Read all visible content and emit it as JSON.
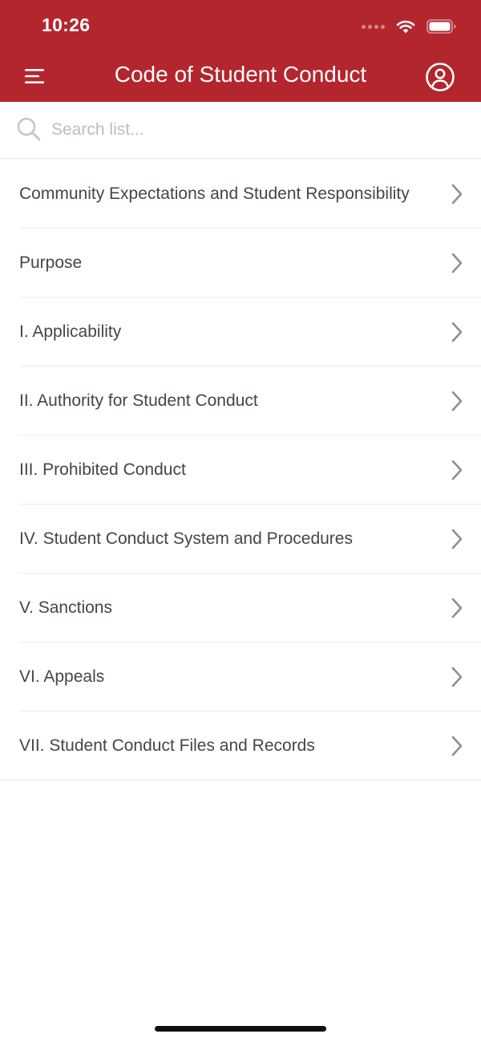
{
  "status_bar": {
    "time": "10:26"
  },
  "nav": {
    "title": "Code of Student Conduct",
    "menu_icon": "hamburger-menu-icon",
    "account_icon": "user-circle-icon"
  },
  "search": {
    "placeholder": "Search list...",
    "value": ""
  },
  "list": {
    "items": [
      {
        "label": "Community Expectations and Student Responsibility"
      },
      {
        "label": "Purpose"
      },
      {
        "label": "I. Applicability"
      },
      {
        "label": "II. Authority for Student Conduct"
      },
      {
        "label": "III. Prohibited Conduct"
      },
      {
        "label": "IV. Student Conduct System and Procedures"
      },
      {
        "label": "V. Sanctions"
      },
      {
        "label": "VI. Appeals"
      },
      {
        "label": "VII. Student Conduct Files and Records"
      }
    ]
  },
  "colors": {
    "brand": "#b3262d",
    "text": "#3f474d",
    "chevron": "#8a9096",
    "placeholder": "#b9bec2"
  }
}
